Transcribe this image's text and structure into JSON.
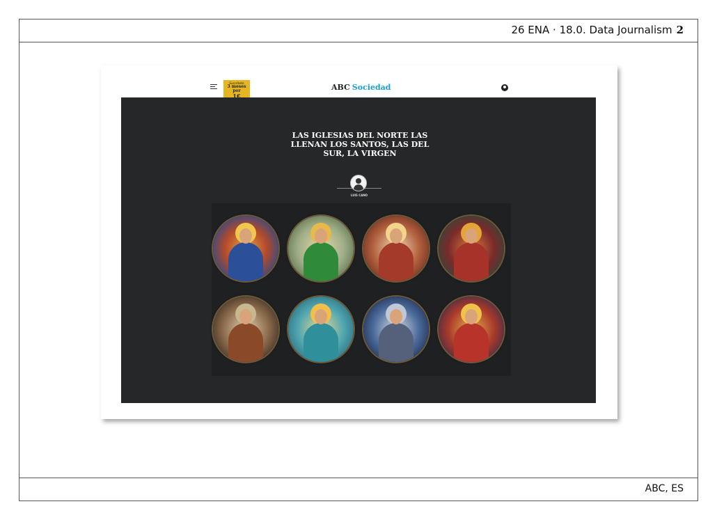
{
  "slide": {
    "header": "26 ENA · 18.0. Data Journalism",
    "page": "2",
    "footer": "ABC, ES"
  },
  "site": {
    "promo_line1": "Suscríbete",
    "promo_line2": "3 meses por",
    "promo_line3": "1€",
    "logo_brand": "ABC",
    "logo_section": "Sociedad"
  },
  "article": {
    "headline": "LAS IGLESIAS DEL NORTE LAS LLENAN LOS SANTOS, LAS DEL SUR, LA VIRGEN",
    "author": "LUIS CANO"
  },
  "saints": [
    {
      "name": "virgin-praying",
      "bg": "radial-gradient(circle,#e2a44a 0%,#b54a2a 45%,#2a4a8a 80%)",
      "robe": "#2c4f9a",
      "halo": "#f0c850"
    },
    {
      "name": "saint-green",
      "bg": "radial-gradient(circle,#e9d7a8 0%,#9fae88 50%,#5a6f4a 85%)",
      "robe": "#2f8a3a",
      "halo": "#e8b84a"
    },
    {
      "name": "virgin-child",
      "bg": "radial-gradient(circle,#f1d9b8 0%,#b2623e 50%,#6a2a1e 85%)",
      "robe": "#a33a2a",
      "halo": "#f2d58a"
    },
    {
      "name": "saint-red",
      "bg": "radial-gradient(circle,#d87a3a 0%,#7a2a2a 50%,#2a4a3a 85%)",
      "robe": "#a6322a",
      "halo": "#e3a43a"
    },
    {
      "name": "saint-john",
      "bg": "radial-gradient(circle,#e0d0b0 0%,#8a6a4a 50%,#3a2a22 85%)",
      "robe": "#8a4a2a",
      "halo": "#c8b890"
    },
    {
      "name": "virgin-teal",
      "bg": "radial-gradient(circle,#f0d890 0%,#4fa6b0 50%,#2a6a7a 85%)",
      "robe": "#2f8f9a",
      "halo": "#f2c04a"
    },
    {
      "name": "archangel",
      "bg": "radial-gradient(circle,#d6dbe2 0%,#4a6a9a 50%,#1f2a4a 85%)",
      "robe": "#55607a",
      "halo": "#c0c8d8"
    },
    {
      "name": "saint-soldier",
      "bg": "radial-gradient(circle,#e8b04a 0%,#a83a2a 50%,#3a2a4a 85%)",
      "robe": "#b8342a",
      "halo": "#f0c24a"
    }
  ]
}
